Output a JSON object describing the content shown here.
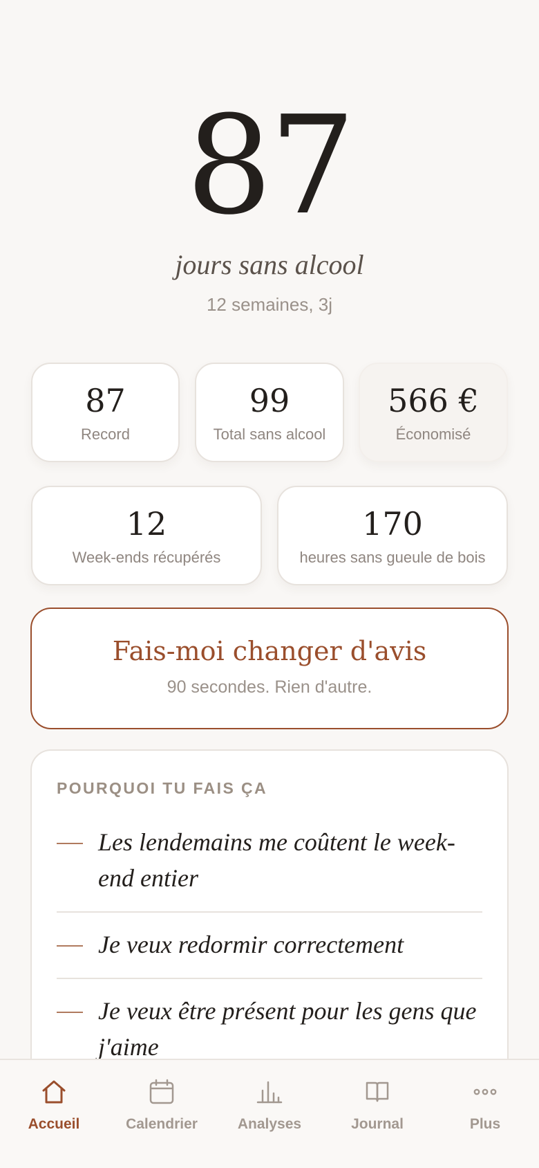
{
  "hero": {
    "count": "87",
    "caption": "jours sans alcool",
    "subtitle": "12 semaines, 3j"
  },
  "stats": {
    "record": {
      "value": "87",
      "label": "Record"
    },
    "total": {
      "value": "99",
      "label": "Total sans alcool"
    },
    "saved": {
      "value": "566 €",
      "label": "Économisé"
    },
    "weekends": {
      "value": "12",
      "label": "Week-ends récupérés"
    },
    "hours": {
      "value": "170",
      "label": "heures sans gueule de bois"
    }
  },
  "cta": {
    "title": "Fais-moi changer d'avis",
    "subtitle": "90 secondes. Rien d'autre."
  },
  "reasons": {
    "heading": "Pourquoi tu fais ça",
    "items": [
      "Les lendemains me coûtent le week-end entier",
      "Je veux redormir correctement",
      "Je veux être présent pour les gens que j'aime"
    ]
  },
  "tabbar": {
    "active": "Accueil",
    "tabs": [
      {
        "label": "Accueil",
        "icon": "home-icon"
      },
      {
        "label": "Calendrier",
        "icon": "calendar-icon"
      },
      {
        "label": "Analyses",
        "icon": "bar-chart-icon"
      },
      {
        "label": "Journal",
        "icon": "book-icon"
      },
      {
        "label": "Plus",
        "icon": "more-icon"
      }
    ]
  },
  "colors": {
    "accent": "#9a4e2c",
    "background": "#f9f7f5",
    "text": "#231f1c",
    "muted": "#9a918a"
  }
}
